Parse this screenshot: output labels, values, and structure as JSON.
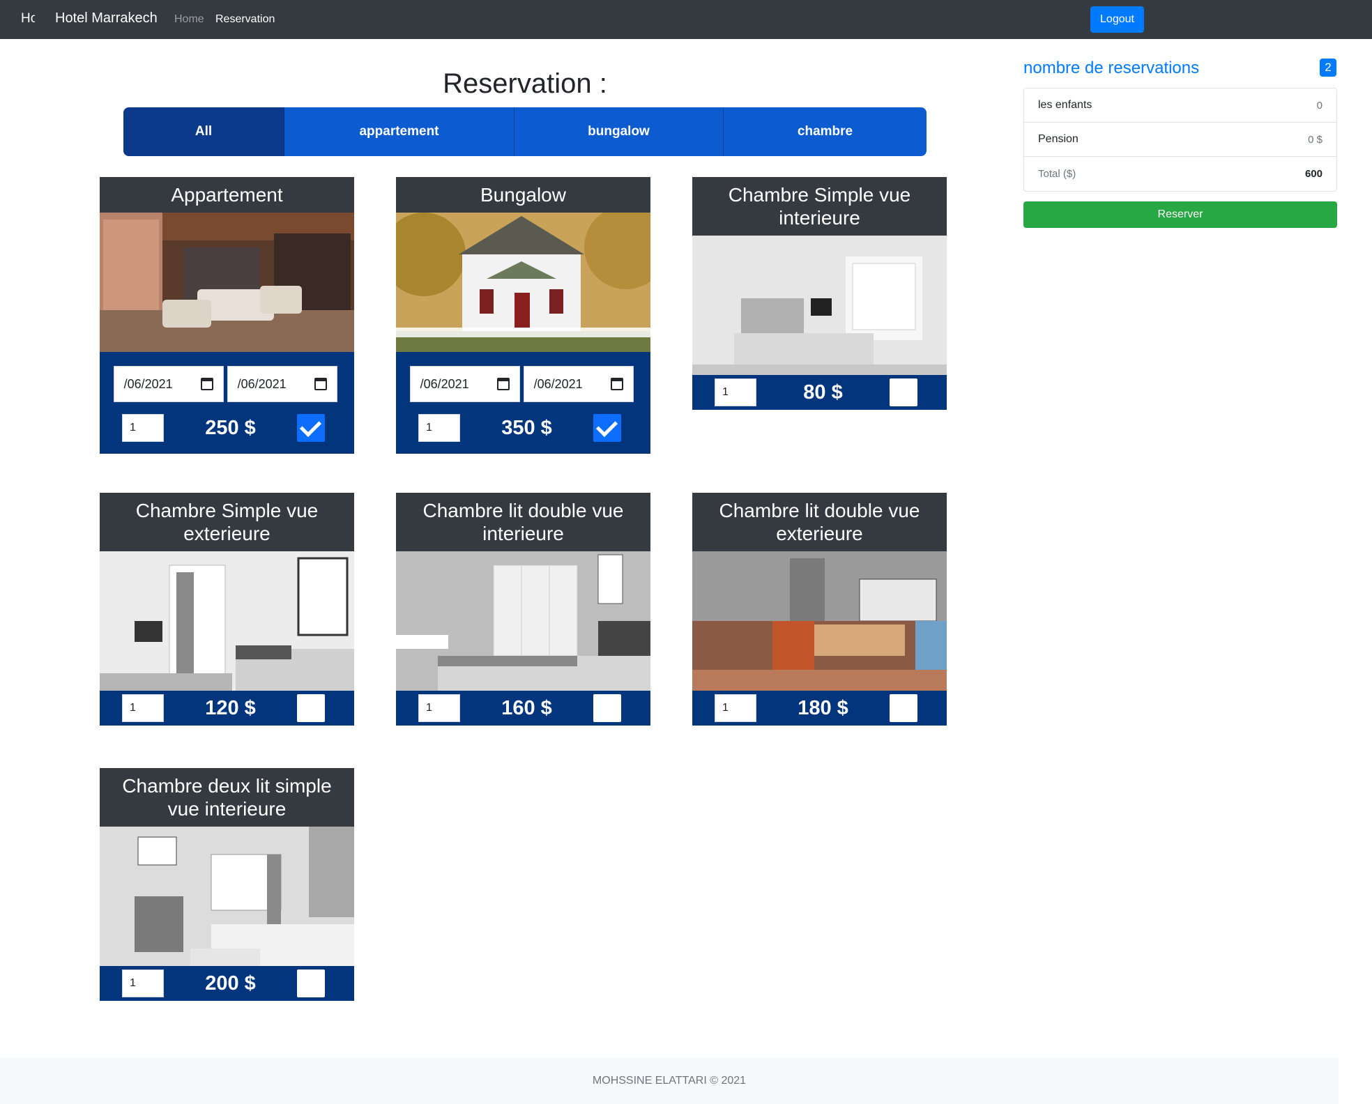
{
  "navbar": {
    "logo_text": "Hotel Marrakech",
    "brand": "Hotel Marrakech",
    "home": "Home",
    "reservation": "Reservation",
    "logout": "Logout"
  },
  "main": {
    "title": "Reservation :",
    "filters": [
      "All",
      "appartement",
      "bungalow",
      "chambre"
    ],
    "active_filter": "All"
  },
  "cards": [
    {
      "title": "Appartement",
      "date_from": " /06/2021",
      "date_to": " /06/2021",
      "qty": "1",
      "price": "250 $",
      "checked": true,
      "image": "living-room-photo"
    },
    {
      "title": "Bungalow",
      "date_from": " /06/2021",
      "date_to": " /06/2021",
      "qty": "1",
      "price": "350 $",
      "checked": true,
      "image": "house-photo"
    },
    {
      "title": "Chambre Simple vue interieure",
      "qty": "1",
      "price": "80 $",
      "checked": false,
      "image": "bedroom-photo"
    },
    {
      "title": "Chambre Simple vue exterieure",
      "qty": "1",
      "price": "120 $",
      "checked": false,
      "image": "bedroom-photo"
    },
    {
      "title": "Chambre lit double vue interieure",
      "qty": "1",
      "price": "160 $",
      "checked": false,
      "image": "bedroom-photo"
    },
    {
      "title": "Chambre lit double vue exterieure",
      "qty": "1",
      "price": "180 $",
      "checked": false,
      "image": "kitchen-photo"
    },
    {
      "title": "Chambre deux lit simple vue interieure",
      "qty": "1",
      "price": "200 $",
      "checked": false,
      "image": "bedroom-photo"
    }
  ],
  "sidebar": {
    "title": "nombre de reservations",
    "count": "2",
    "rows": [
      {
        "label": "les enfants",
        "value": "0"
      },
      {
        "label": "Pension",
        "value": "0 $"
      },
      {
        "label": "Total ($)",
        "value": "600"
      }
    ],
    "reserve_button": "Reserver"
  },
  "footer": {
    "text": "MOHSSINE ELATTARI © 2021"
  },
  "colors": {
    "navbar": "#343a40",
    "primary": "#007bff",
    "card_body": "#03357d",
    "success": "#28a745"
  }
}
